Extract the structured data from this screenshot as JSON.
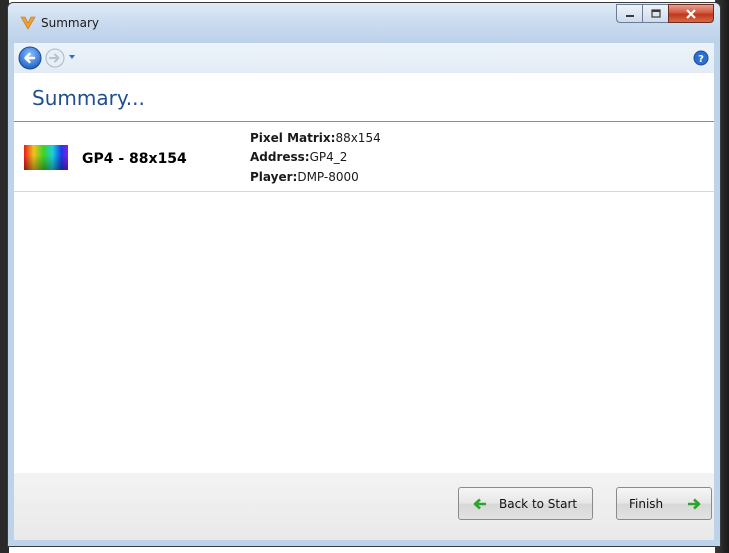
{
  "window": {
    "title": "Summary",
    "icon": "app-logo-icon"
  },
  "nav": {
    "back_icon": "back-arrow-icon",
    "forward_icon": "forward-arrow-icon",
    "help_icon": "help-icon"
  },
  "page": {
    "heading": "Summary..."
  },
  "items": [
    {
      "name": "GP4 - 88x154",
      "details": [
        {
          "label": "Pixel Matrix:",
          "value": "88x154"
        },
        {
          "label": "Address:",
          "value": "GP4_2"
        },
        {
          "label": "Player:",
          "value": "DMP-8000"
        }
      ]
    }
  ],
  "footer": {
    "back_label": "Back to Start",
    "finish_label": "Finish"
  },
  "colors": {
    "heading": "#1f4f8f",
    "arrow_green": "#2ca52c"
  }
}
